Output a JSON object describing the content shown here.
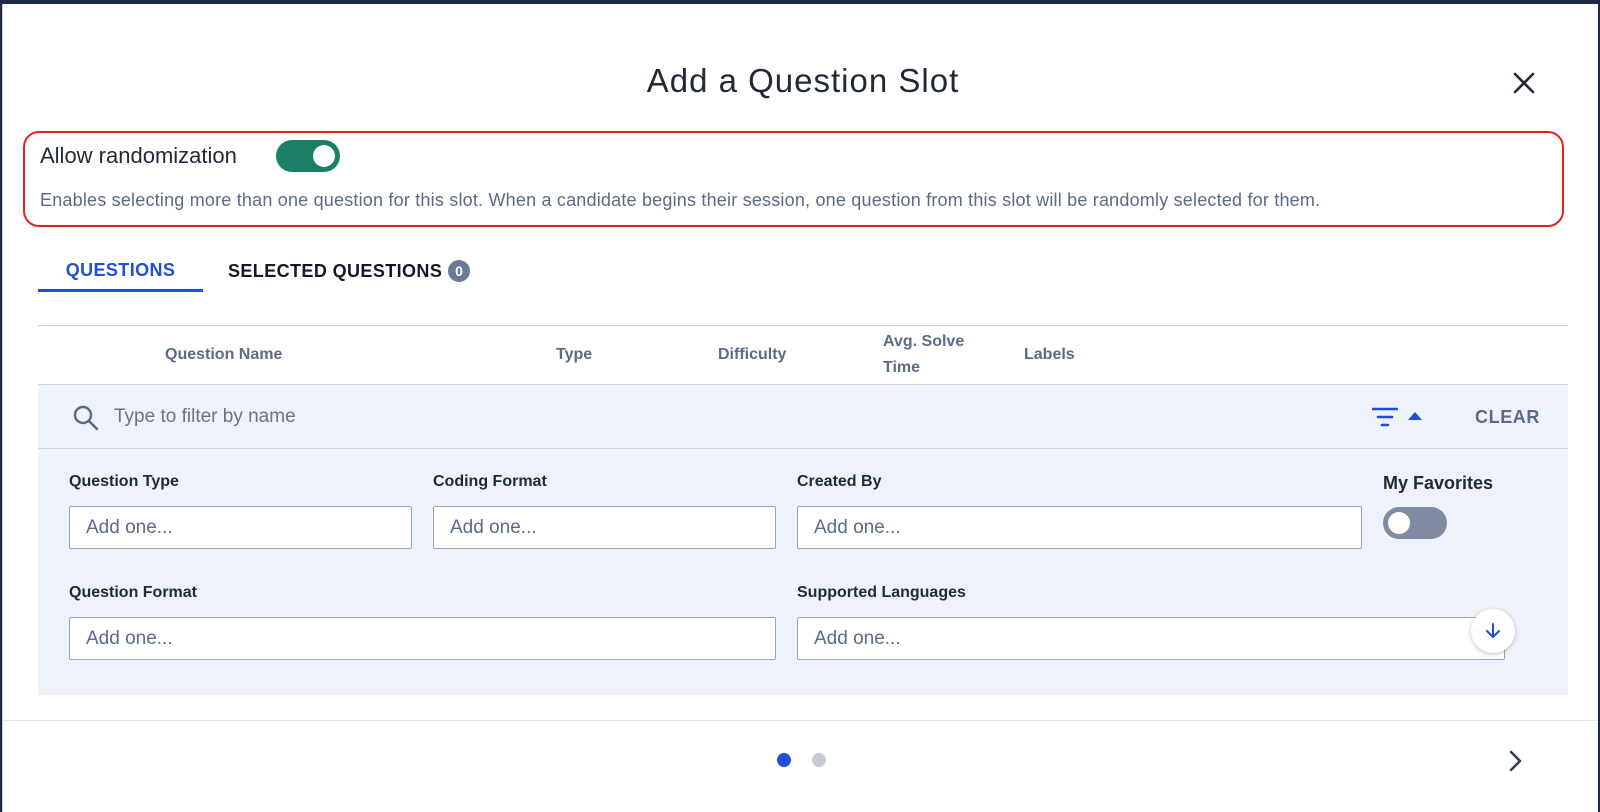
{
  "modal": {
    "title": "Add a Question Slot"
  },
  "randomization": {
    "label": "Allow randomization",
    "enabled": true,
    "description": "Enables selecting more than one question for this slot. When a candidate begins their session, one question from this slot will be randomly selected for them."
  },
  "tabs": {
    "questions": "QUESTIONS",
    "selected": "SELECTED QUESTIONS",
    "selected_count": "0"
  },
  "table": {
    "headers": {
      "name": "Question Name",
      "type": "Type",
      "difficulty": "Difficulty",
      "solve_time_line1": "Avg. Solve",
      "solve_time_line2": "Time",
      "labels": "Labels"
    }
  },
  "filter": {
    "placeholder": "Type to filter by name",
    "clear_label": "CLEAR"
  },
  "filters": {
    "question_type": {
      "label": "Question Type",
      "placeholder": "Add one..."
    },
    "coding_format": {
      "label": "Coding Format",
      "placeholder": "Add one..."
    },
    "created_by": {
      "label": "Created By",
      "placeholder": "Add one..."
    },
    "my_favorites": {
      "label": "My Favorites",
      "enabled": false
    },
    "question_format": {
      "label": "Question Format",
      "placeholder": "Add one..."
    },
    "supported_languages": {
      "label": "Supported Languages",
      "placeholder": "Add one..."
    }
  },
  "pagination": {
    "pages": 2,
    "current": 1
  },
  "colors": {
    "accent": "#1f4ed8",
    "toggle_on": "#1a7f64",
    "highlight_border": "#e02424",
    "filter_bg": "#eef2fb"
  }
}
